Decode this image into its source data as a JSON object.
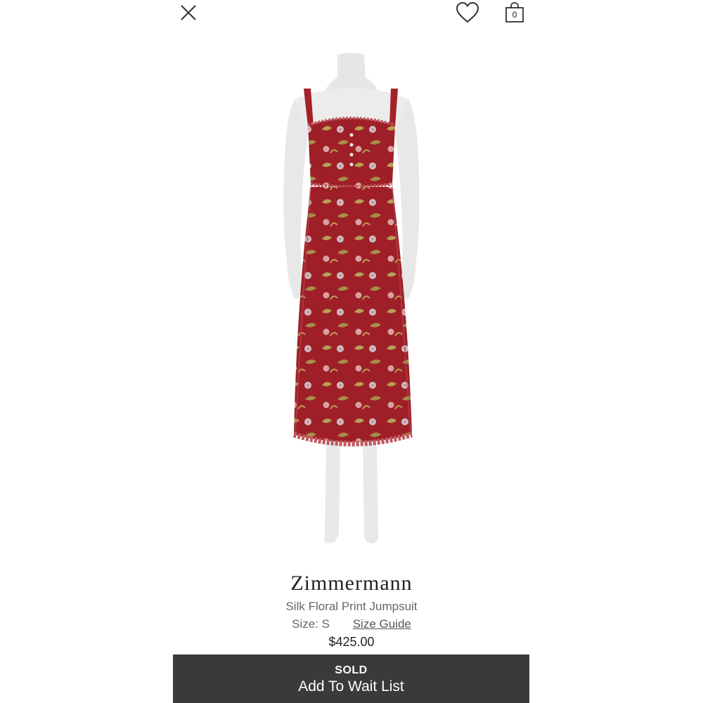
{
  "header": {
    "close_icon": "close-icon",
    "favorite_icon": "heart-icon",
    "bag_icon": "shopping-bag-icon",
    "bag_count": "0"
  },
  "product": {
    "image_alt": "Silk Floral Print Jumpsuit on mannequin",
    "brand": "Zimmermann",
    "name": "Silk Floral Print Jumpsuit",
    "size": "Size: S",
    "size_guide_label": "Size Guide",
    "price": "$425.00",
    "colors": {
      "garment": "#9e1f27",
      "print_leaf": "#b8a054",
      "print_flower": "#c8c0c8"
    }
  },
  "cta": {
    "status": "SOLD",
    "label": "Add To Wait List",
    "background": "#3a3a3a"
  }
}
